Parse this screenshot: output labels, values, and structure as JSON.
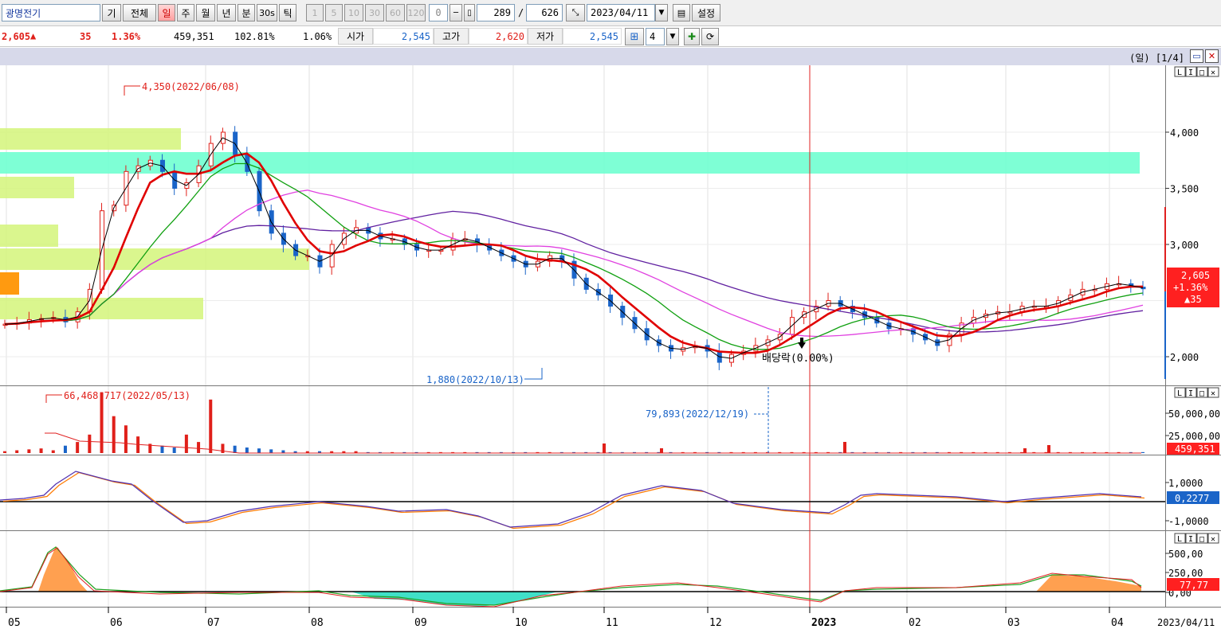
{
  "toolbar": {
    "stock_name": "광명전기",
    "buttons": [
      "기",
      "전체"
    ],
    "period_buttons": [
      "일",
      "주",
      "월",
      "년",
      "분",
      "30s",
      "틱"
    ],
    "active_period": "일",
    "minute_buttons": [
      "1",
      "5",
      "10",
      "30",
      "60",
      "120"
    ],
    "count_value": "0",
    "page_current": "289",
    "page_sep": "/",
    "page_total": "626",
    "date_value": "2023/04/11",
    "settings_label": "설정"
  },
  "quote": {
    "price": "2,605",
    "change": "35",
    "change_pct": "1.36%",
    "volume": "459,351",
    "vol_ratio": "102.81%",
    "turnover": "1.06%",
    "open_label": "시가",
    "open_value": "2,545",
    "high_label": "고가",
    "high_value": "2,620",
    "low_label": "저가",
    "low_value": "2,545",
    "layout_count": "4"
  },
  "titlebar": {
    "period_info": "(일) [1/4]"
  },
  "annotations": {
    "high": "4,350(2022/06/08)",
    "low": "1,880(2022/10/13)",
    "vol_high": "66,468,717(2022/05/13)",
    "vol_low": "79,893(2022/12/19)",
    "dividend": "배당락(0.00%)"
  },
  "price_axis": [
    "4,000",
    "3,500",
    "3,000",
    "2,000"
  ],
  "price_tag": {
    "price": "2,605",
    "pct": "+1.36%",
    "chg": "▲35"
  },
  "volume_axis": [
    "50,000,00",
    "25,000,00"
  ],
  "volume_tag": "459,351",
  "macd_axis": [
    "1,0000",
    "-1,0000"
  ],
  "macd_tag": "0,2277",
  "osc_axis": [
    "500,00",
    "250,00",
    "0,00"
  ],
  "osc_tag": "77,77",
  "x_axis": [
    "05",
    "06",
    "07",
    "08",
    "09",
    "10",
    "11",
    "12",
    "2023",
    "02",
    "03",
    "04"
  ],
  "x_axis_end": "2023/04/11",
  "colors": {
    "up": "#e0201a",
    "down": "#1a64c8",
    "ma5": "#000000",
    "ma20": "#e00000",
    "ma60": "#10a010",
    "ma120": "#e040e0",
    "ma240": "#6020a0",
    "zone_green": "#d4f57a",
    "zone_cyan": "#70ffd0"
  },
  "chart_data": {
    "type": "candlestick",
    "title": "광명전기",
    "date_range": [
      "2022-04",
      "2023-04-11"
    ],
    "last_close": 2605,
    "high": {
      "value": 4350,
      "date": "2022-06-08"
    },
    "low": {
      "value": 1880,
      "date": "2022-10-13"
    },
    "close_series": [
      2290,
      2300,
      2330,
      2340,
      2350,
      2310,
      2400,
      2600,
      3300,
      3350,
      3650,
      3700,
      3750,
      3650,
      3500,
      3550,
      3700,
      3900,
      4000,
      3800,
      3650,
      3300,
      3100,
      3000,
      2900,
      2900,
      2800,
      3000,
      3100,
      3150,
      3100,
      3050,
      3050,
      3000,
      2950,
      2950,
      2950,
      3050,
      3050,
      3000,
      2950,
      2900,
      2850,
      2800,
      2850,
      2900,
      2850,
      2700,
      2600,
      2550,
      2450,
      2350,
      2250,
      2150,
      2100,
      2050,
      2080,
      2100,
      2050,
      1950,
      2020,
      2050,
      2100,
      2150,
      2200,
      2350,
      2400,
      2450,
      2500,
      2450,
      2400,
      2350,
      2300,
      2250,
      2250,
      2200,
      2150,
      2100,
      2200,
      2300,
      2350,
      2380,
      2400,
      2400,
      2450,
      2450,
      2450,
      2500,
      2550,
      2600,
      2600,
      2650,
      2650,
      2620,
      2605
    ],
    "volume_peak": 66468717,
    "volume_last": 459351
  }
}
